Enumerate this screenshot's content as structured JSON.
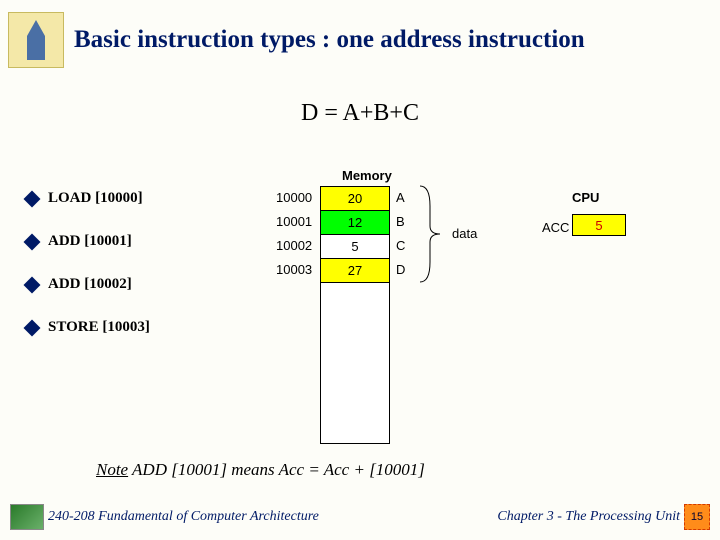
{
  "title": "Basic instruction types : one address instruction",
  "formula": "D = A+B+C",
  "bullets": [
    "LOAD [10000]",
    "ADD [10001]",
    "ADD [10002]",
    "STORE [10003]"
  ],
  "memory": {
    "header": "Memory",
    "rows": [
      {
        "addr": "10000",
        "val": "20",
        "name": "A",
        "cls": "row-yellow"
      },
      {
        "addr": "10001",
        "val": "12",
        "name": "B",
        "cls": "row-green"
      },
      {
        "addr": "10002",
        "val": "5",
        "name": "C",
        "cls": "row-white"
      },
      {
        "addr": "10003",
        "val": "27",
        "name": "D",
        "cls": "row-yellow"
      }
    ],
    "data_label": "data"
  },
  "cpu": {
    "header": "CPU",
    "acc_label": "ACC",
    "acc_value": "5"
  },
  "note": {
    "prefix": "Note",
    "body": " ADD [10001]  means   Acc = Acc + [10001]"
  },
  "footer": {
    "left": "240-208 Fundamental of Computer Architecture",
    "right": "Chapter 3 - The Processing Unit",
    "page": "15"
  }
}
